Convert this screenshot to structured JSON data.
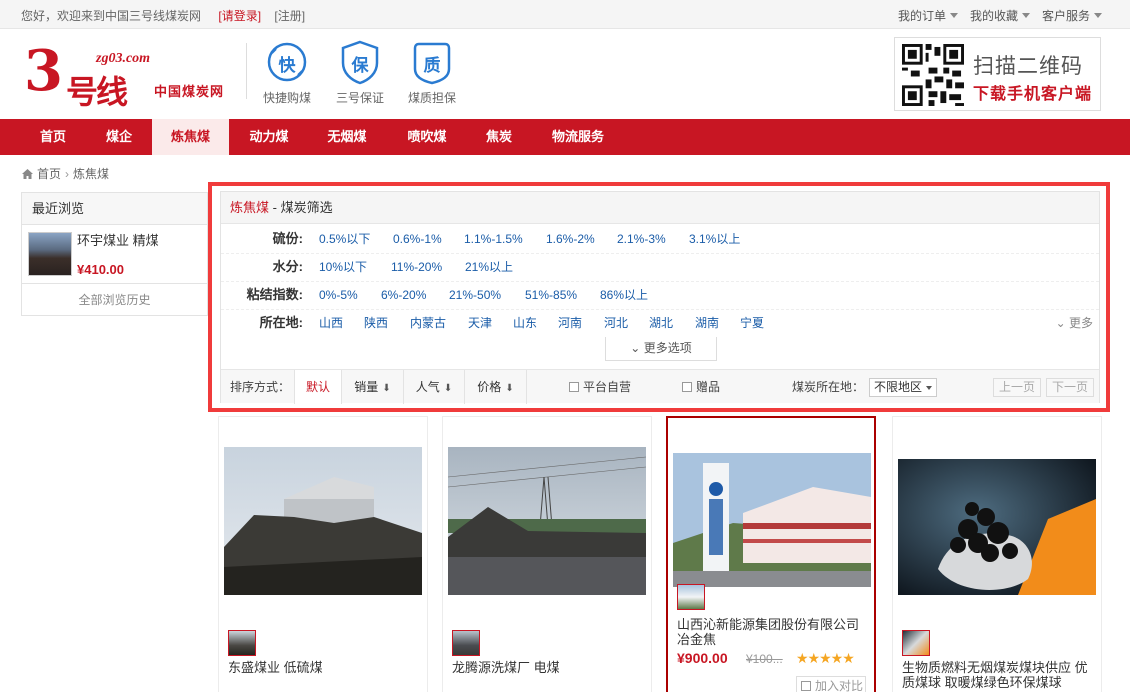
{
  "topbar": {
    "greeting": "您好，欢迎来到中国三号线煤炭网",
    "login": "[请登录]",
    "register": "[注册]",
    "my_orders": "我的订单",
    "my_favorites": "我的收藏",
    "customer_service": "客户服务"
  },
  "logo": {
    "digit": "3",
    "domain": "zg03.com",
    "brand": "号线",
    "tagline": "中国煤炭网"
  },
  "features": [
    {
      "glyph": "快",
      "label": "快捷购煤"
    },
    {
      "glyph": "保",
      "label": "三号保证"
    },
    {
      "glyph": "质",
      "label": "煤质担保"
    }
  ],
  "qr": {
    "line1": "扫描二维码",
    "line2": "下载手机客户端"
  },
  "nav": [
    "首页",
    "煤企",
    "炼焦煤",
    "动力煤",
    "无烟煤",
    "喷吹煤",
    "焦炭",
    "物流服务"
  ],
  "nav_active_index": 2,
  "breadcrumb": {
    "home": "首页",
    "current": "炼焦煤"
  },
  "sidebar": {
    "title": "最近浏览",
    "item_name": "环宇煤业 精煤",
    "item_price": "¥410.00",
    "history_link": "全部浏览历史"
  },
  "filter": {
    "category": "炼焦煤",
    "title_suffix": " - 煤炭筛选",
    "rows": [
      {
        "label": "硫份:",
        "options": [
          "0.5%以下",
          "0.6%-1%",
          "1.1%-1.5%",
          "1.6%-2%",
          "2.1%-3%",
          "3.1%以上"
        ]
      },
      {
        "label": "水分:",
        "options": [
          "10%以下",
          "11%-20%",
          "21%以上"
        ]
      },
      {
        "label": "粘结指数:",
        "options": [
          "0%-5%",
          "6%-20%",
          "21%-50%",
          "51%-85%",
          "86%以上"
        ]
      },
      {
        "label": "所在地:",
        "options": [
          "山西",
          "陕西",
          "内蒙古",
          "天津",
          "山东",
          "河南",
          "河北",
          "湖北",
          "湖南",
          "宁夏"
        ]
      }
    ],
    "more": "更多",
    "more_options": "更多选项"
  },
  "sort": {
    "label": "排序方式：",
    "tabs": [
      "默认",
      "销量",
      "人气",
      "价格"
    ],
    "self_operated": "平台自营",
    "gift": "赠品",
    "region_label": "煤炭所在地：",
    "region_value": "不限地区",
    "prev": "上一页",
    "next": "下一页"
  },
  "products": [
    {
      "name": "东盛煤业 低硫煤",
      "price": "",
      "orig_price": "",
      "compare": ""
    },
    {
      "name": "龙腾源洗煤厂 电煤",
      "price": "",
      "orig_price": "",
      "compare": ""
    },
    {
      "name": "山西沁新能源集团股份有限公司 冶金焦",
      "price": "¥900.00",
      "orig_price": "¥100...",
      "stars": "★★★★★",
      "compare": "加入对比"
    },
    {
      "name": "生物质燃料无烟煤炭煤块供应 优质煤球 取暖煤绿色环保煤球",
      "price": "",
      "orig_price": "",
      "compare": ""
    }
  ],
  "colors": {
    "brand_red": "#c81623",
    "link_blue": "#1a5ca8",
    "highlight": "#f03b3b"
  }
}
